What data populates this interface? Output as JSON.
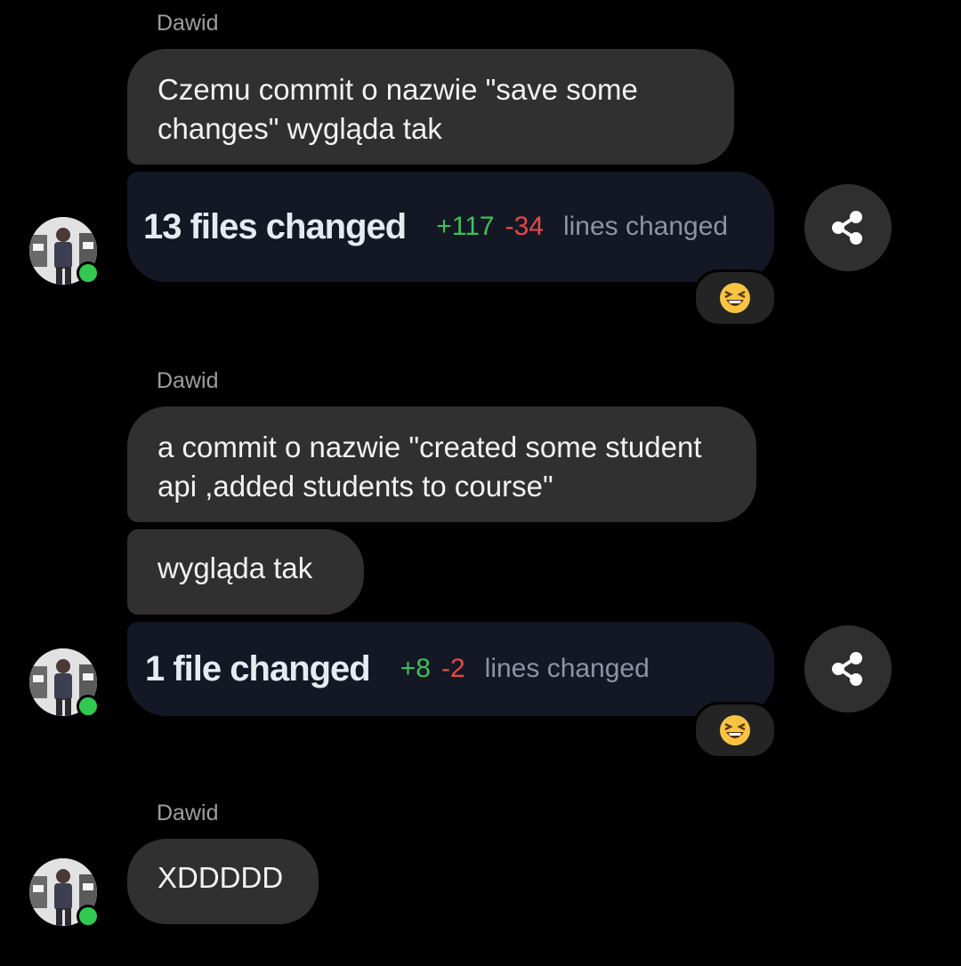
{
  "messages": [
    {
      "sender": "Dawid",
      "texts": [
        "Czemu commit o nazwie \"save some changes\" wygląda tak"
      ],
      "commit": {
        "files": "13 files changed",
        "additions": "+117",
        "deletions": "-34",
        "lines_label": "lines changed"
      },
      "reaction": "😆"
    },
    {
      "sender": "Dawid",
      "texts": [
        "a commit o nazwie \"created some student api ,added students to course\"",
        "wygląda tak"
      ],
      "commit": {
        "files": "1 file changed",
        "additions": "+8",
        "deletions": "-2",
        "lines_label": "lines changed"
      },
      "reaction": "😆"
    },
    {
      "sender": "Dawid",
      "texts": [
        "XDDDDD"
      ]
    }
  ],
  "icons": {
    "share": "share-icon",
    "reaction": "laughing-emoji-icon",
    "avatar": "user-avatar",
    "status": "online-status-icon"
  },
  "colors": {
    "background": "#000000",
    "bubble": "#303030",
    "commit_card": "#141824",
    "additions": "#3fbf5a",
    "deletions": "#e84848",
    "online": "#31c950"
  }
}
